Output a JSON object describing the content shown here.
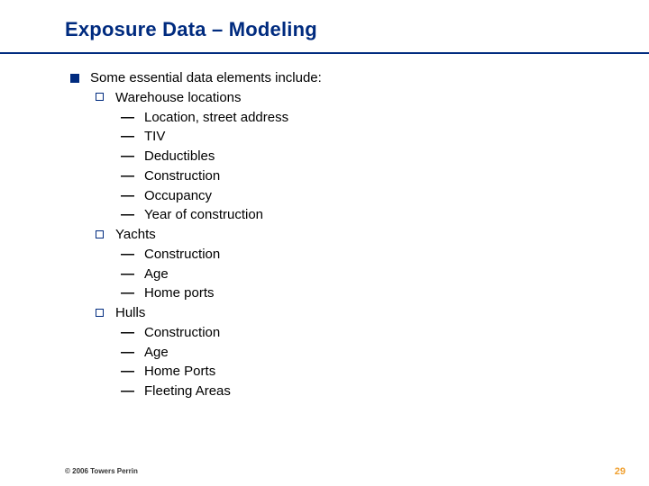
{
  "title": "Exposure Data – Modeling",
  "intro": "Some essential data elements include:",
  "groups": [
    {
      "label": "Warehouse locations",
      "items": [
        "Location, street address",
        "TIV",
        "Deductibles",
        "Construction",
        "Occupancy",
        "Year of construction"
      ]
    },
    {
      "label": "Yachts",
      "items": [
        "Construction",
        "Age",
        "Home ports"
      ]
    },
    {
      "label": "Hulls",
      "items": [
        "Construction",
        "Age",
        "Home Ports",
        "Fleeting Areas"
      ]
    }
  ],
  "footer": {
    "copyright": "© 2006 Towers Perrin",
    "page": "29"
  }
}
